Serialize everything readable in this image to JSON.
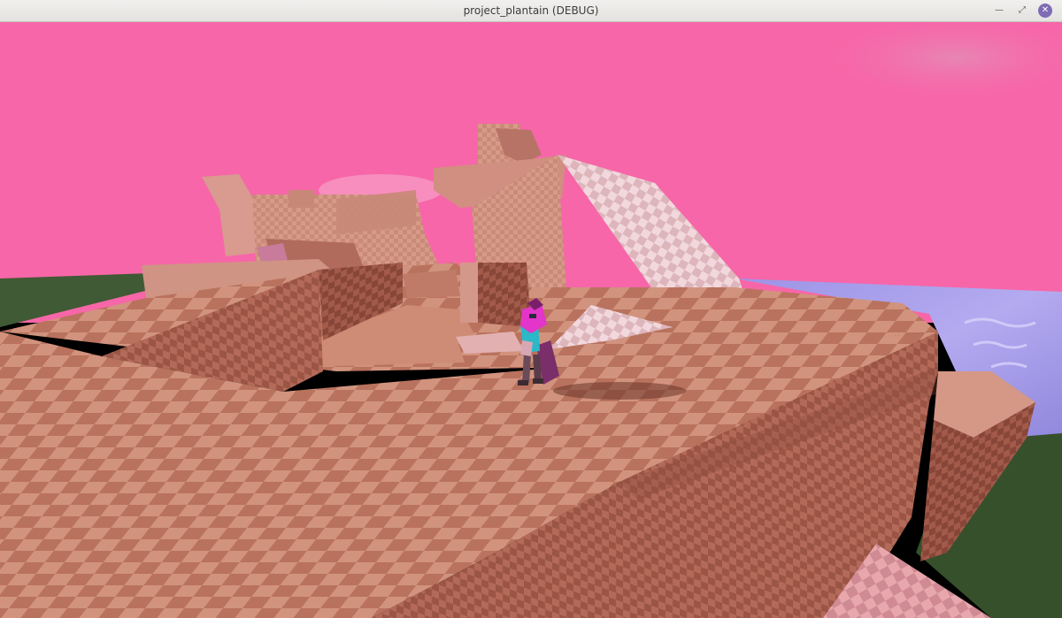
{
  "window": {
    "title": "project_plantain (DEBUG)",
    "controls": {
      "minimize_glyph": "—",
      "maximize_glyph": "⤢",
      "close_glyph": "✕"
    }
  },
  "scene": {
    "sky_color": "#f766a8",
    "ground_color": "#c98873",
    "water_color": "#a39ae0",
    "grass_color": "#3d5530",
    "character_accent": "#e335c9"
  }
}
